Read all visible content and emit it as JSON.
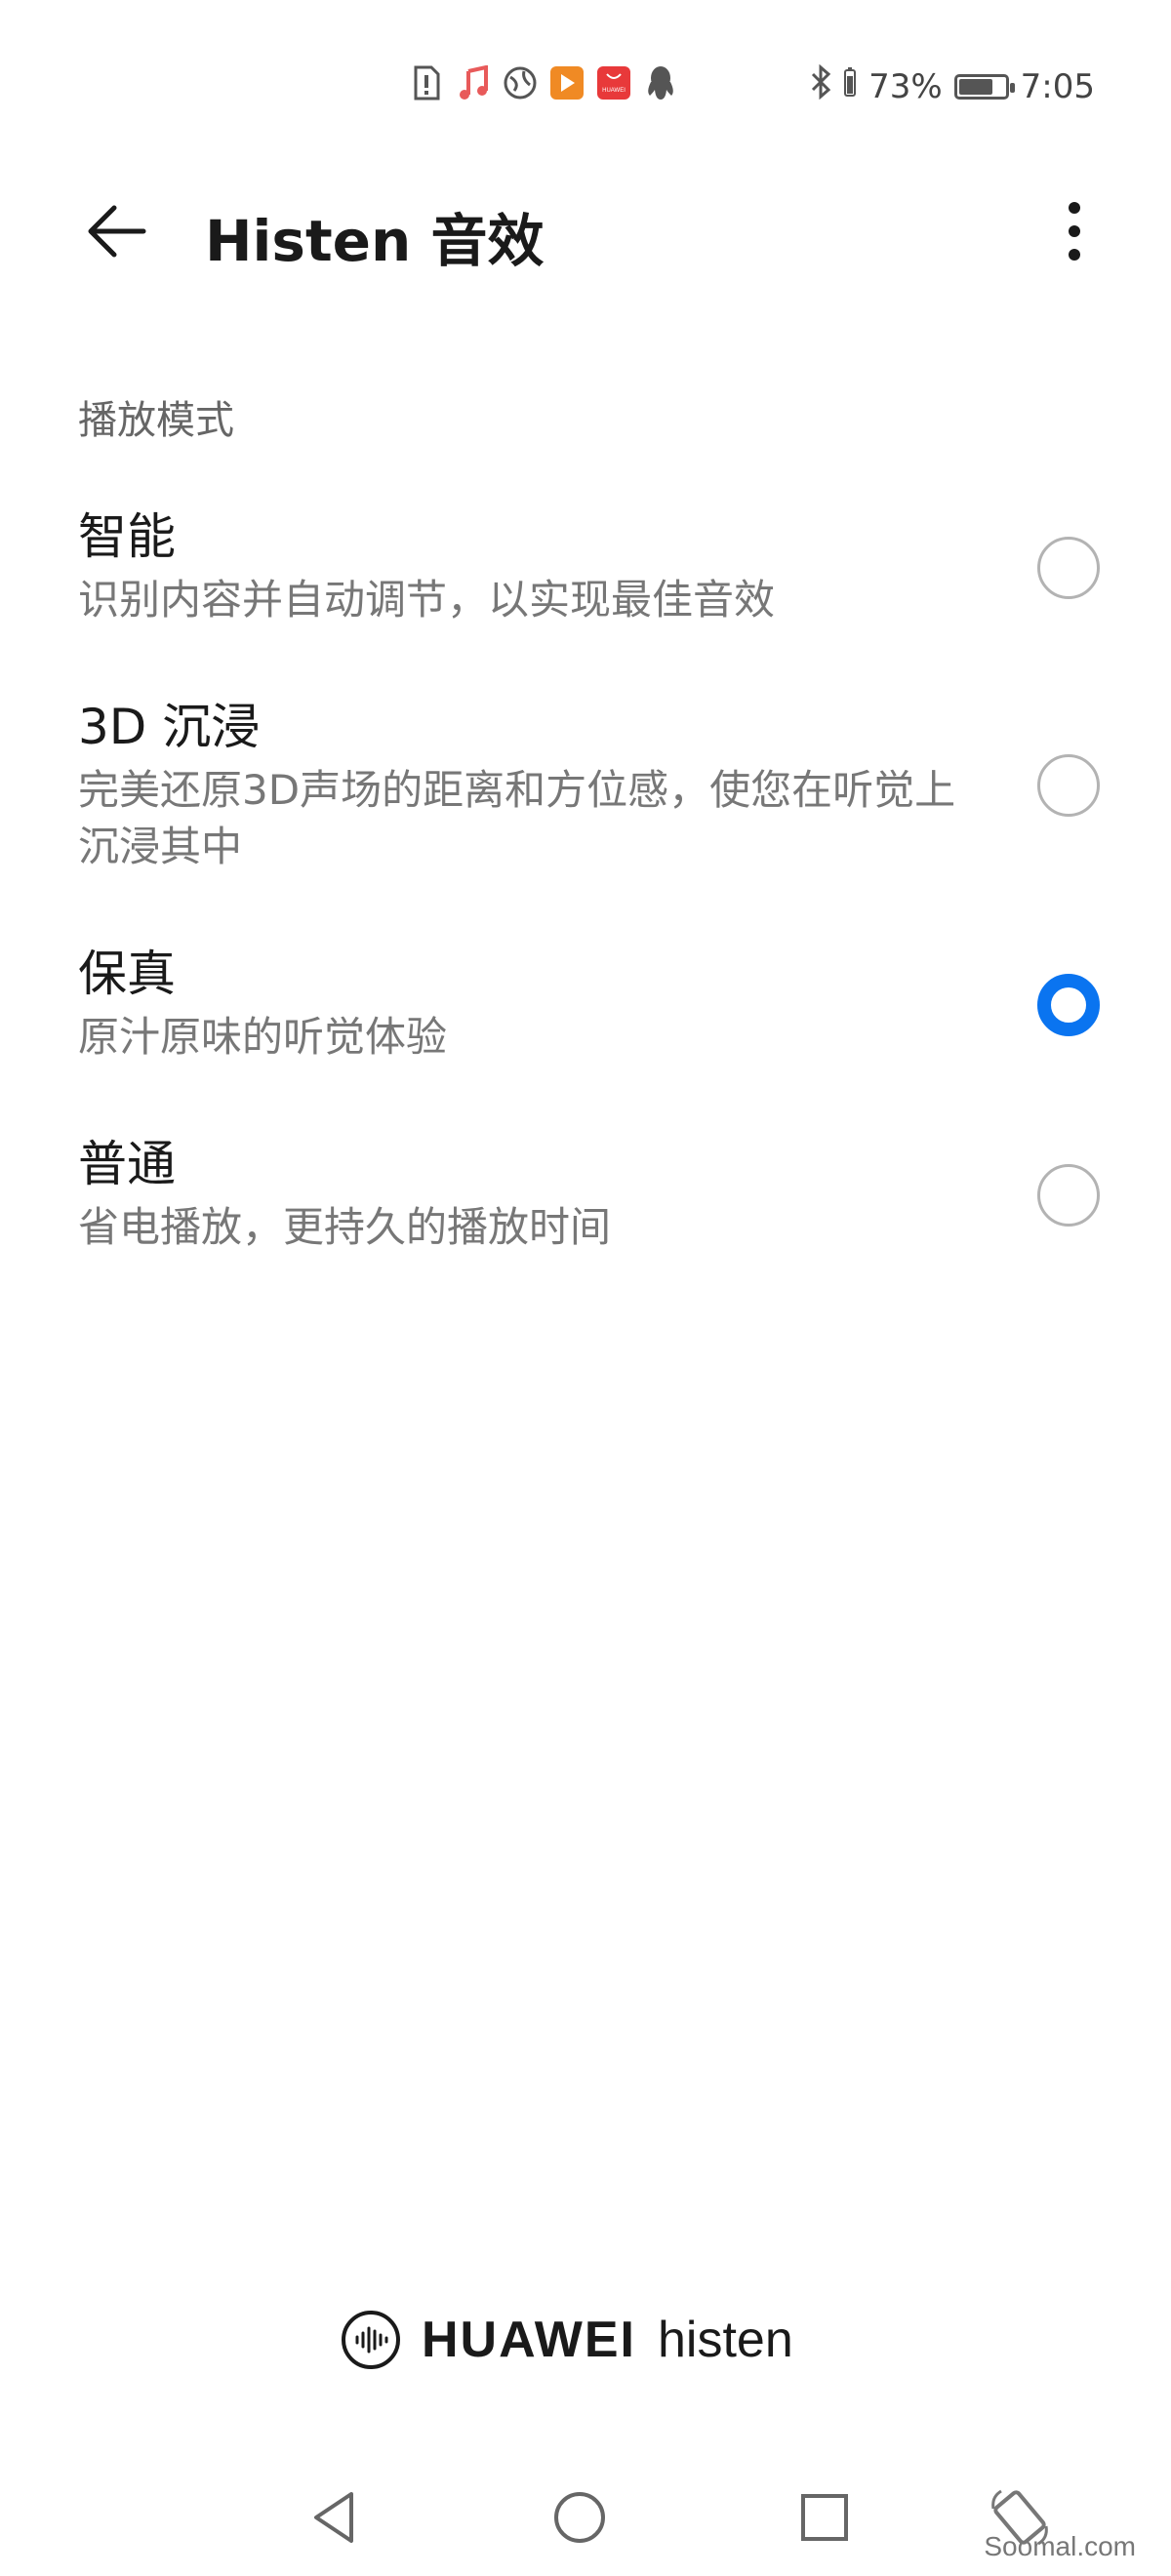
{
  "status_bar": {
    "notification_icons": [
      "sim-alert-icon",
      "music-icon",
      "vpn-icon",
      "video-icon",
      "huawei-store-icon",
      "qq-icon"
    ],
    "store_icon_text": "HUAWEI",
    "battery_percent": "73%",
    "battery_level": 0.73,
    "time": "7:05"
  },
  "header": {
    "title": "Histen 音效"
  },
  "section": {
    "title": "播放模式"
  },
  "options": [
    {
      "title": "智能",
      "desc": "识别内容并自动调节，以实现最佳音效",
      "checked": false
    },
    {
      "title": "3D 沉浸",
      "desc": "完美还原3D声场的距离和方位感，使您在听觉上沉浸其中",
      "checked": false
    },
    {
      "title": "保真",
      "desc": "原汁原味的听觉体验",
      "checked": true
    },
    {
      "title": "普通",
      "desc": "省电播放，更持久的播放时间",
      "checked": false
    }
  ],
  "brand": {
    "name": "HUAWEI",
    "sub": "histen"
  },
  "watermark": "Soomal.com",
  "colors": {
    "accent": "#0a74f0",
    "title_text": "#1a1a1a",
    "secondary_text": "#777777"
  }
}
